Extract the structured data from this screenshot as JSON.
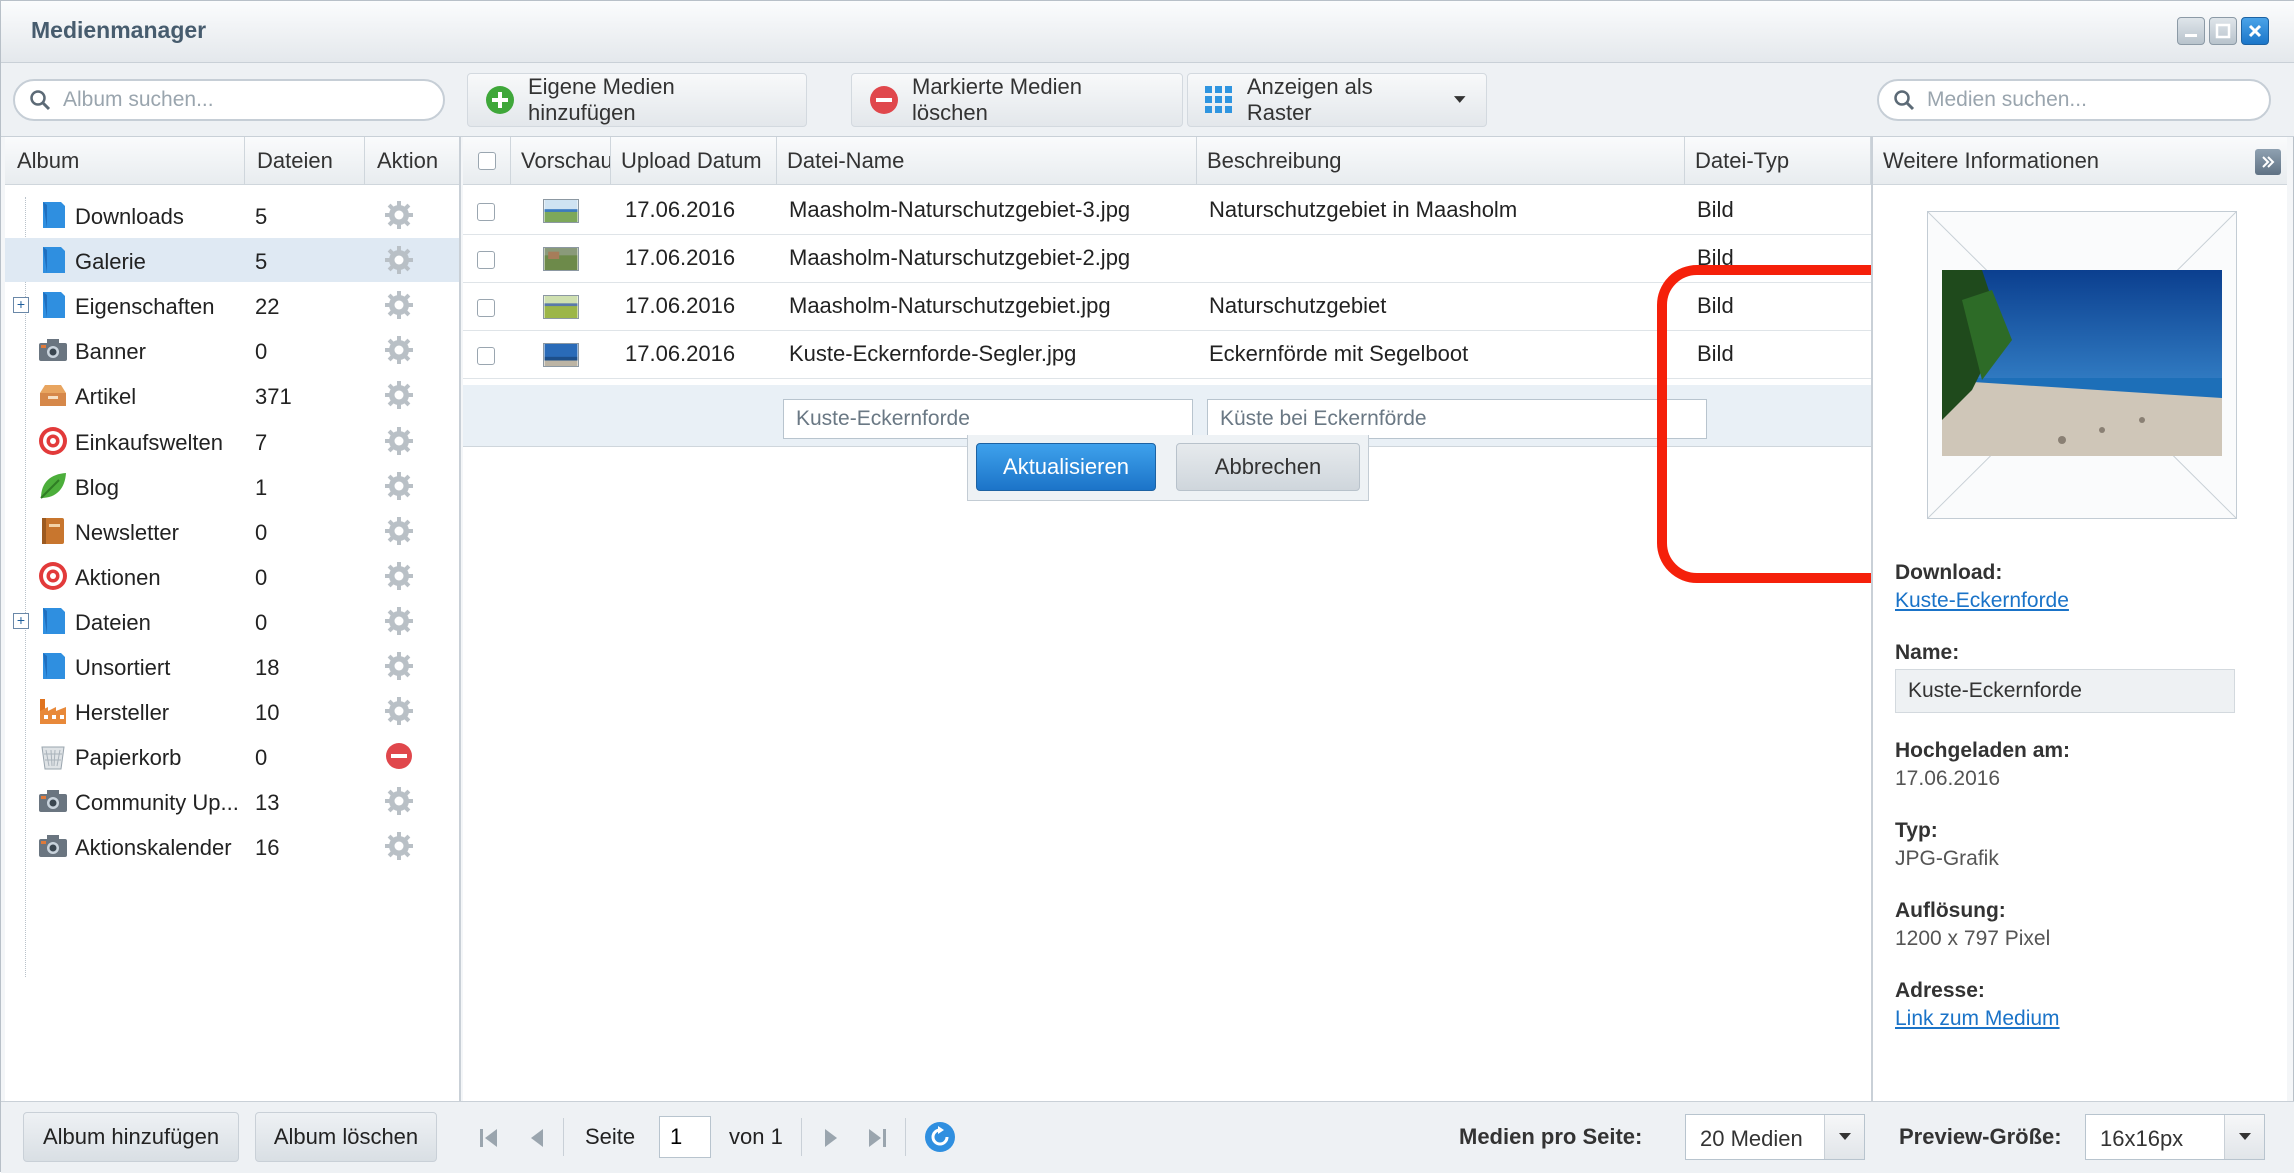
{
  "window": {
    "title": "Medienmanager"
  },
  "toolbar": {
    "album_search_placeholder": "Album suchen...",
    "add_media_label": "Eigene Medien hinzufügen",
    "delete_marked_label": "Markierte Medien löschen",
    "view_grid_label": "Anzeigen als Raster",
    "media_search_placeholder": "Medien suchen..."
  },
  "albums": {
    "headers": {
      "album": "Album",
      "files": "Dateien",
      "action": "Aktion"
    },
    "items": [
      {
        "name": "Downloads",
        "count": "5",
        "icon": "folder-icon",
        "selected": false,
        "expandable": false
      },
      {
        "name": "Galerie",
        "count": "5",
        "icon": "folder-icon",
        "selected": true,
        "expandable": false
      },
      {
        "name": "Eigenschaften",
        "count": "22",
        "icon": "folder-icon",
        "selected": false,
        "expandable": true
      },
      {
        "name": "Banner",
        "count": "0",
        "icon": "camera-icon",
        "selected": false,
        "expandable": false
      },
      {
        "name": "Artikel",
        "count": "371",
        "icon": "box-icon",
        "selected": false,
        "expandable": false
      },
      {
        "name": "Einkaufswelten",
        "count": "7",
        "icon": "target-icon",
        "selected": false,
        "expandable": false
      },
      {
        "name": "Blog",
        "count": "1",
        "icon": "leaf-icon",
        "selected": false,
        "expandable": false
      },
      {
        "name": "Newsletter",
        "count": "0",
        "icon": "book-icon",
        "selected": false,
        "expandable": false
      },
      {
        "name": "Aktionen",
        "count": "0",
        "icon": "target-icon",
        "selected": false,
        "expandable": false
      },
      {
        "name": "Dateien",
        "count": "0",
        "icon": "folder-icon",
        "selected": false,
        "expandable": true
      },
      {
        "name": "Unsortiert",
        "count": "18",
        "icon": "folder-icon",
        "selected": false,
        "expandable": false
      },
      {
        "name": "Hersteller",
        "count": "10",
        "icon": "factory-icon",
        "selected": false,
        "expandable": false
      },
      {
        "name": "Papierkorb",
        "count": "0",
        "icon": "trash-icon",
        "selected": false,
        "expandable": false,
        "action": "delete"
      },
      {
        "name": "Community Up...",
        "count": "13",
        "icon": "camera-icon",
        "selected": false,
        "expandable": false
      },
      {
        "name": "Aktionskalender",
        "count": "16",
        "icon": "camera-icon",
        "selected": false,
        "expandable": false
      }
    ],
    "add_album_label": "Album hinzufügen",
    "delete_album_label": "Album löschen"
  },
  "grid": {
    "headers": {
      "preview": "Vorschau",
      "upload_date": "Upload Datum",
      "file_name": "Datei-Name",
      "description": "Beschreibung",
      "file_type": "Datei-Typ"
    },
    "rows": [
      {
        "upload_date": "17.06.2016",
        "file_name": "Maasholm-Naturschutzgebiet-3.jpg",
        "description": "Naturschutzgebiet in Maasholm",
        "file_type": "Bild"
      },
      {
        "upload_date": "17.06.2016",
        "file_name": "Maasholm-Naturschutzgebiet-2.jpg",
        "description": "",
        "file_type": "Bild"
      },
      {
        "upload_date": "17.06.2016",
        "file_name": "Maasholm-Naturschutzgebiet.jpg",
        "description": "Naturschutzgebiet",
        "file_type": "Bild"
      },
      {
        "upload_date": "17.06.2016",
        "file_name": "Kuste-Eckernforde-Segler.jpg",
        "description": "Eckernförde mit Segelboot",
        "file_type": "Bild"
      }
    ],
    "edit": {
      "name_value": "Kuste-Eckernforde",
      "description_value": "Küste bei Eckernförde",
      "update_label": "Aktualisieren",
      "cancel_label": "Abbrechen"
    },
    "highlight_color": "#f5200a"
  },
  "info": {
    "header": "Weitere Informationen",
    "download_label": "Download:",
    "download_link": "Kuste-Eckernforde",
    "name_label": "Name:",
    "name_value": "Kuste-Eckernforde",
    "uploaded_label": "Hochgeladen am:",
    "uploaded_value": "17.06.2016",
    "type_label": "Typ:",
    "type_value": "JPG-Grafik",
    "resolution_label": "Auflösung:",
    "resolution_value": "1200 x 797 Pixel",
    "address_label": "Adresse:",
    "address_link": "Link zum Medium"
  },
  "footer": {
    "page_label": "Seite",
    "page_value": "1",
    "of_label": "von 1",
    "per_page_label": "Medien pro Seite:",
    "per_page_value": "20 Medien",
    "preview_size_label": "Preview-Größe:",
    "preview_size_value": "16x16px"
  },
  "colors": {
    "accent": "#1b76c9",
    "selected_row": "#dfe9f3",
    "link": "#1a73c8"
  }
}
